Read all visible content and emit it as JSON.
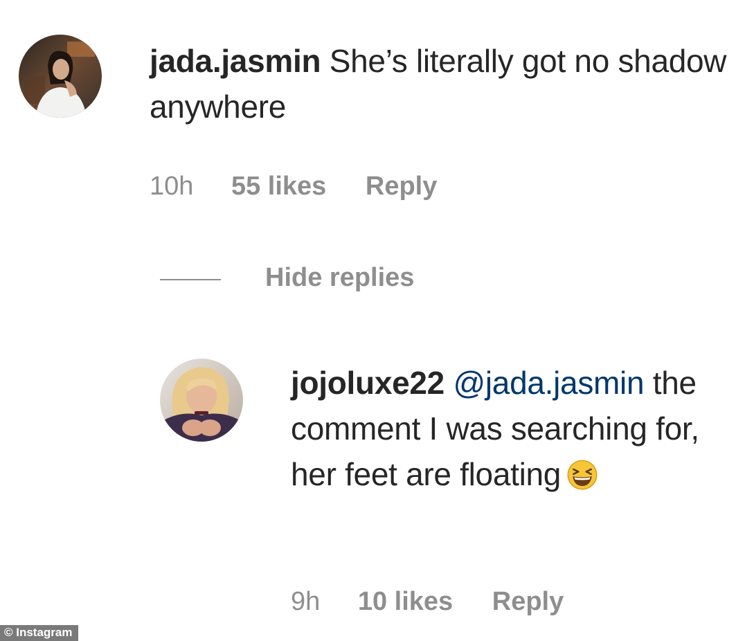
{
  "comments": [
    {
      "username": "jada.jasmin",
      "text": "She’s literally got no shadow anywhere",
      "time": "10h",
      "likes": "55 likes",
      "reply": "Reply",
      "avatar_icon": "profile-photo"
    }
  ],
  "thread": {
    "hide_replies": "Hide replies"
  },
  "replies": [
    {
      "username": "jojoluxe22",
      "mention": "@jada.jasmin",
      "text": "the comment I was searching for, her feet are floating",
      "emoji": "grinning-squinting-face",
      "time": "9h",
      "likes": "10 likes",
      "reply": "Reply",
      "avatar_icon": "profile-photo"
    }
  ],
  "watermark": "© Instagram",
  "colors": {
    "text": "#262626",
    "meta": "#8e8e8e",
    "mention": "#00376b",
    "background": "#ffffff"
  }
}
